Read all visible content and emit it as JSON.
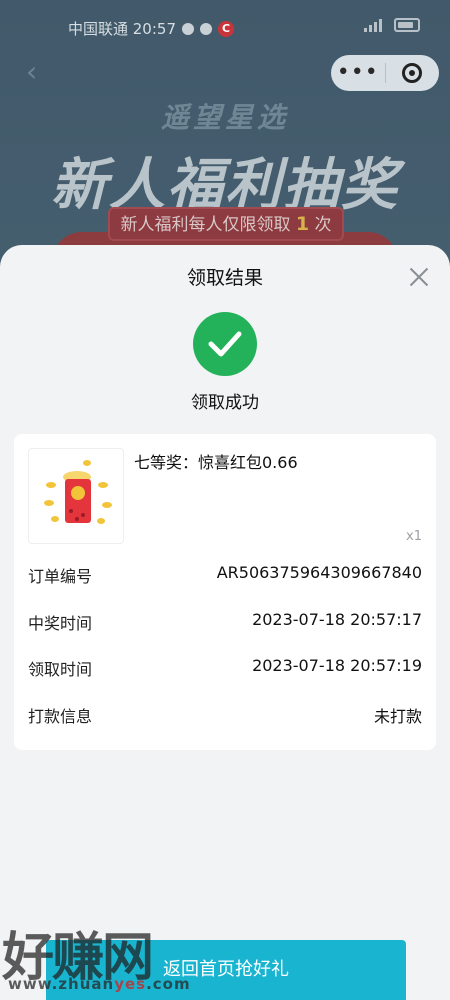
{
  "status_bar": {
    "carrier_time": "中国联通 20:57",
    "app_badge": "C",
    "icons": [
      "snapchat-icon",
      "wechat-icon",
      "c-app-icon",
      "signal-icon",
      "battery-icon"
    ]
  },
  "background_page": {
    "subtitle": "遥望星选",
    "title": "新人福利抽奖",
    "notice_prefix": "新人福利每人仅限领取",
    "notice_count": "1",
    "notice_suffix": "次"
  },
  "sheet": {
    "title": "领取结果",
    "success_text": "领取成功",
    "prize": {
      "name": "七等奖：惊喜红包0.66",
      "quantity": "x1"
    },
    "details": [
      {
        "label": "订单编号",
        "value": "AR506375964309667840"
      },
      {
        "label": "中奖时间",
        "value": "2023-07-18 20:57:17"
      },
      {
        "label": "领取时间",
        "value": "2023-07-18 20:57:19"
      },
      {
        "label": "打款信息",
        "value": "未打款"
      }
    ],
    "bottom_button": "返回首页抢好礼"
  },
  "watermark": {
    "cn": "好赚网",
    "url_a": "www.zhuan",
    "url_b": "yes",
    "url_c": ".com"
  },
  "colors": {
    "success": "#23b259",
    "button": "#19b5d0",
    "sheet_bg": "#f2f3f5"
  }
}
